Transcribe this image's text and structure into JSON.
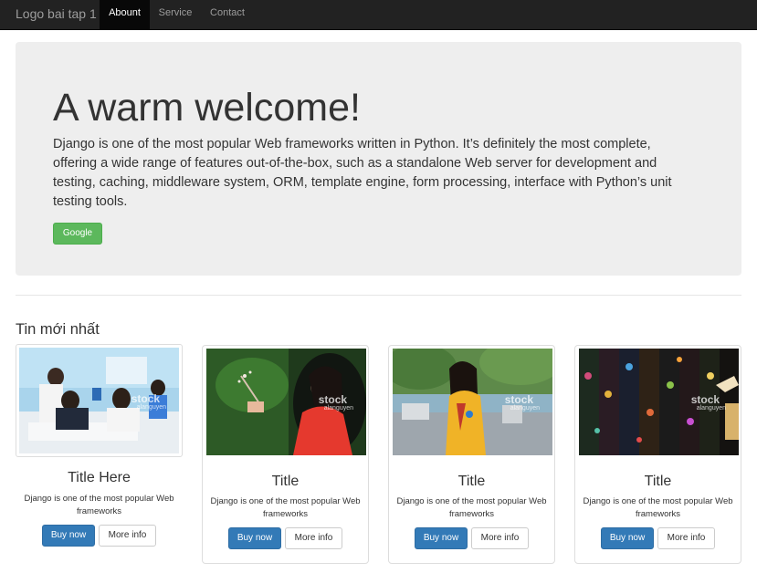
{
  "navbar": {
    "brand": "Logo bai tap 1",
    "items": [
      {
        "label": "Abount",
        "active": true
      },
      {
        "label": "Service",
        "active": false
      },
      {
        "label": "Contact",
        "active": false
      }
    ]
  },
  "jumbotron": {
    "title": "A warm welcome!",
    "text": "Django is one of the most popular Web frameworks written in Python. It’s definitely the most complete, offering a wide range of features out-of-the-box, such as a standalone Web server for development and testing, caching, middleware system, ORM, template engine, form processing, interface with Python’s unit testing tools.",
    "button_label": "Google"
  },
  "news": {
    "title": "Tin mới nhất",
    "watermark": {
      "main": "stock",
      "sub": "alanguyen"
    },
    "cards": [
      {
        "image": "classroom-photo",
        "title": "Title Here",
        "text": "Django is one of the most popular Web frameworks",
        "buy_label": "Buy now",
        "more_label": "More info"
      },
      {
        "image": "woman-red-dress-photo",
        "title": "Title",
        "text": "Django is one of the most popular Web frameworks",
        "buy_label": "Buy now",
        "more_label": "More info"
      },
      {
        "image": "woman-ao-dai-street-photo",
        "title": "Title",
        "text": "Django is one of the most popular Web frameworks",
        "buy_label": "Buy now",
        "more_label": "More info"
      },
      {
        "image": "embroidery-fabric-photo",
        "title": "Title",
        "text": "Django is one of the most popular Web frameworks",
        "buy_label": "Buy now",
        "more_label": "More info"
      }
    ]
  },
  "colors": {
    "navbar": "#222222",
    "jumbotron": "#eeeeee",
    "success": "#5cb85c",
    "primary": "#337ab7"
  }
}
